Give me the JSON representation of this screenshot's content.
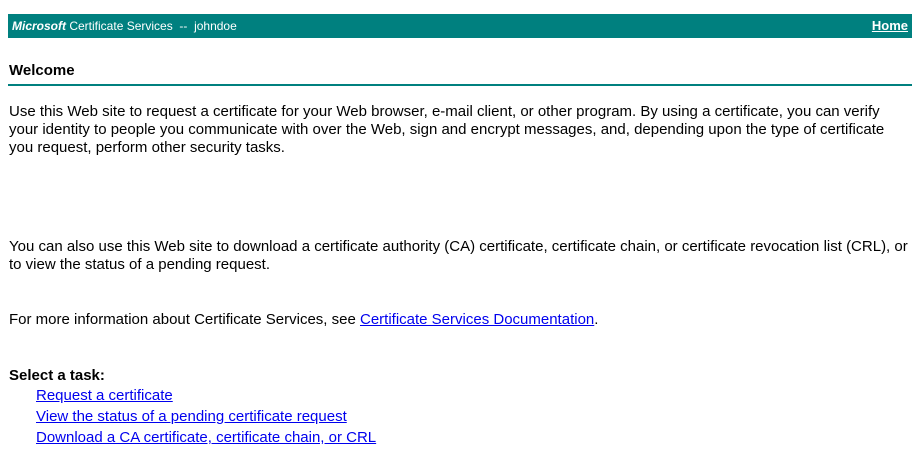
{
  "header": {
    "brand": "Microsoft",
    "title": "Certificate Services",
    "separator": "--",
    "user": "johndoe",
    "home_link": "Home"
  },
  "page": {
    "title": "Welcome",
    "paragraph1": "Use this Web site to request a certificate for your Web browser, e-mail client, or other program. By using a certificate, you can verify your identity to people you communicate with over the Web, sign and encrypt messages, and, depending upon the type of certificate you request, perform other security tasks.",
    "paragraph2": "You can also use this Web site to download a certificate authority (CA) certificate, certificate chain, or certificate revocation list (CRL), or to view the status of a pending request.",
    "more_info_prefix": "For more information about Certificate Services, see ",
    "more_info_link": "Certificate Services Documentation",
    "more_info_suffix": "."
  },
  "tasks": {
    "heading": "Select a task:",
    "items": [
      {
        "label": "Request a certificate"
      },
      {
        "label": "View the status of a pending certificate request"
      },
      {
        "label": "Download a CA certificate, certificate chain, or CRL"
      }
    ]
  },
  "colors": {
    "header_bg": "#00807f",
    "link": "#0000ee"
  }
}
